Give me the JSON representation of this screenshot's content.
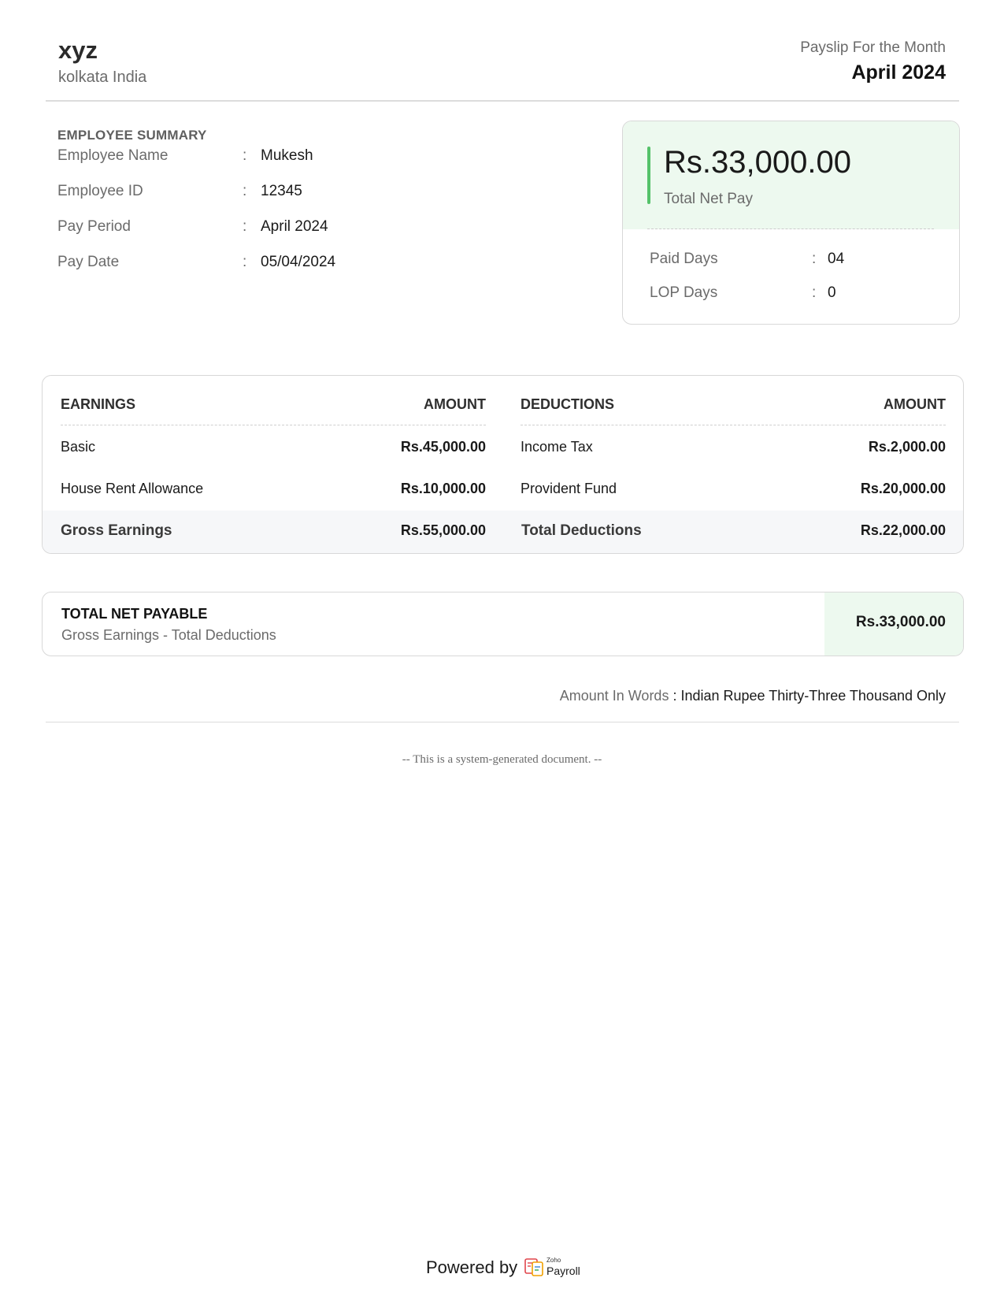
{
  "company": {
    "name": "xyz",
    "address": "kolkata India"
  },
  "header": {
    "payslip_label": "Payslip For the Month",
    "month": "April 2024"
  },
  "employee_summary": {
    "title": "EMPLOYEE SUMMARY",
    "separator": ":",
    "rows": [
      {
        "label": "Employee Name",
        "value": "Mukesh"
      },
      {
        "label": "Employee ID",
        "value": "12345"
      },
      {
        "label": "Pay Period",
        "value": "April 2024"
      },
      {
        "label": "Pay Date",
        "value": "05/04/2024"
      }
    ]
  },
  "net_pay_card": {
    "amount": "Rs.33,000.00",
    "label": "Total Net Pay",
    "accent_color": "#55c26a",
    "background_color": "#edf9ef",
    "rows": [
      {
        "label": "Paid Days",
        "value": "04"
      },
      {
        "label": "LOP Days",
        "value": "0"
      }
    ]
  },
  "earnings": {
    "header": "EARNINGS",
    "amount_header": "AMOUNT",
    "items": [
      {
        "label": "Basic",
        "amount": "Rs.45,000.00"
      },
      {
        "label": "House Rent Allowance",
        "amount": "Rs.10,000.00"
      }
    ],
    "total_label": "Gross Earnings",
    "total_amount": "Rs.55,000.00"
  },
  "deductions": {
    "header": "DEDUCTIONS",
    "amount_header": "AMOUNT",
    "items": [
      {
        "label": "Income Tax",
        "amount": "Rs.2,000.00"
      },
      {
        "label": "Provident Fund",
        "amount": "Rs.20,000.00"
      }
    ],
    "total_label": "Total Deductions",
    "total_amount": "Rs.22,000.00"
  },
  "total_net_payable": {
    "title": "TOTAL NET PAYABLE",
    "subtitle": "Gross Earnings - Total Deductions",
    "amount": "Rs.33,000.00"
  },
  "amount_in_words": {
    "label": "Amount In Words",
    "colon": " : ",
    "value": "Indian Rupee Thirty-Three Thousand Only"
  },
  "footer": {
    "system_note": "-- This is a system-generated document. --",
    "powered_by": "Powered by",
    "logo_small": "Zoho",
    "logo_name": "Payroll",
    "logo_icon": "zoho-payroll-icon"
  }
}
